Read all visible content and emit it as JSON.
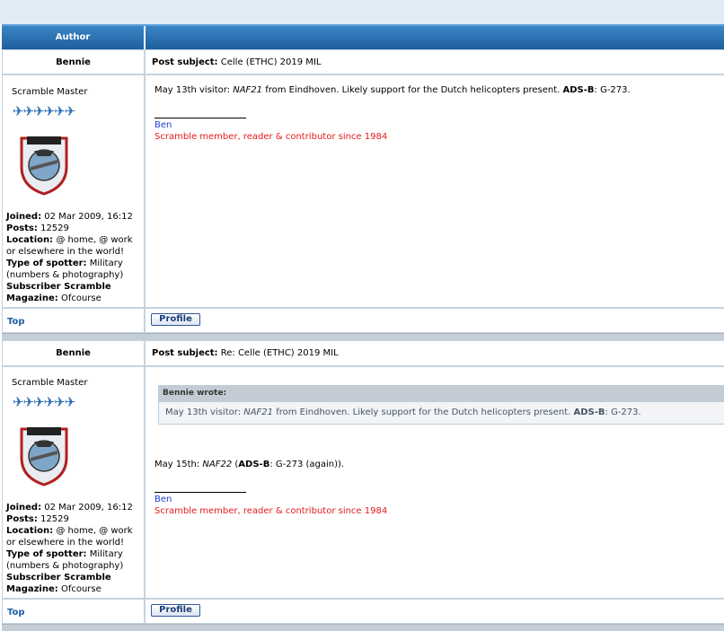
{
  "table_header": {
    "author": "Author"
  },
  "posts": [
    {
      "author": "Bennie",
      "subject_label": "Post subject:",
      "subject": "Celle (ETHC) 2019 MIL",
      "rank": "Scramble Master",
      "stars": "✈✈✈✈✈✈",
      "avatar_text": "S",
      "joined_label": "Joined:",
      "joined": "02 Mar 2009, 16:12",
      "posts_label": "Posts:",
      "posts": "12529",
      "location_label": "Location:",
      "location": "@ home, @ work or elsewhere in the world!",
      "spotter_label": "Type of spotter:",
      "spotter": "Military (numbers & photography)",
      "subscriber_label": "Subscriber Scramble Magazine:",
      "subscriber": "Ofcourse",
      "body_a": "May 13th visitor: ",
      "body_b": "NAF21",
      "body_c": " from Eindhoven. Likely support for the Dutch helicopters present. ",
      "body_d": "ADS-B",
      "body_e": ": G-273.",
      "sig_name": "Ben",
      "sig_text": "Scramble member, reader & contributor since 1984",
      "top_link": "Top",
      "profile_button": "Profile"
    },
    {
      "author": "Bennie",
      "subject_label": "Post subject:",
      "subject": "Re: Celle (ETHC) 2019 MIL",
      "rank": "Scramble Master",
      "stars": "✈✈✈✈✈✈",
      "joined_label": "Joined:",
      "joined": "02 Mar 2009, 16:12",
      "posts_label": "Posts:",
      "posts": "12529",
      "location_label": "Location:",
      "location": "@ home, @ work or elsewhere in the world!",
      "spotter_label": "Type of spotter:",
      "spotter": "Military (numbers & photography)",
      "subscriber_label": "Subscriber Scramble Magazine:",
      "subscriber": "Ofcourse",
      "quote_head": "Bennie wrote:",
      "quote_a": "May 13th visitor: ",
      "quote_b": "NAF21",
      "quote_c": " from Eindhoven. Likely support for the Dutch helicopters present. ",
      "quote_d": "ADS-B",
      "quote_e": ": G-273.",
      "body_a": "May 15th: ",
      "body_b": "NAF22",
      "body_c": " (",
      "body_d": "ADS-B",
      "body_e": ": G-273 (again)).",
      "sig_name": "Ben",
      "sig_text": "Scramble member, reader & contributor since 1984",
      "top_link": "Top",
      "profile_button": "Profile"
    }
  ],
  "colors": {
    "header_blue": "#1e5f9e",
    "link_blue": "#1f5fa5",
    "sig_red": "#e21b1b",
    "sig_blue": "#1f3fd0"
  }
}
